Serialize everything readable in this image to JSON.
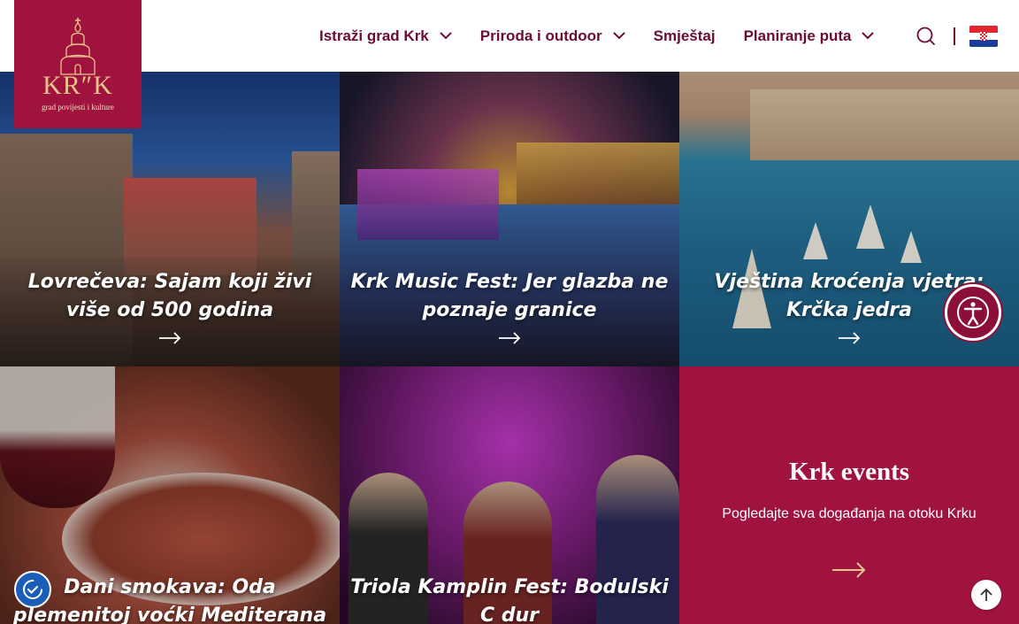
{
  "logo": {
    "wordmark": "KR″K",
    "tagline": "grad povijesti i kulture",
    "bg_color": "#a0133f"
  },
  "nav": {
    "items": [
      {
        "label": "Istraži grad Krk",
        "has_dropdown": true
      },
      {
        "label": "Priroda i outdoor",
        "has_dropdown": true
      },
      {
        "label": "Smještaj",
        "has_dropdown": false
      },
      {
        "label": "Planiranje puta",
        "has_dropdown": true
      }
    ],
    "search_icon": "search-icon",
    "language_icon": "croatian-flag-icon",
    "text_color": "#6b0d33"
  },
  "tiles": [
    {
      "title": "Lovrečeva: Sajam koji živi više od 500 godina"
    },
    {
      "title": "Krk Music Fest: Jer glazba ne poznaje granice"
    },
    {
      "title": "Vještina kroćenja vjetra: Krčka jedra"
    },
    {
      "title": "Dani smokava: Oda plemenitoj voćki Mediterana"
    },
    {
      "title": "Triola Kamplin Fest: Bodulski C dur"
    }
  ],
  "events": {
    "title": "Krk events",
    "text": "Pogledajte sva događanja na otoku Krku",
    "arrow_color": "#e6c48a",
    "bg_color": "#a0133f"
  },
  "floating": {
    "accessibility_icon": "accessibility-icon",
    "scroll_top_icon": "arrow-up-icon",
    "cookie_icon": "cookie-consent-icon"
  }
}
